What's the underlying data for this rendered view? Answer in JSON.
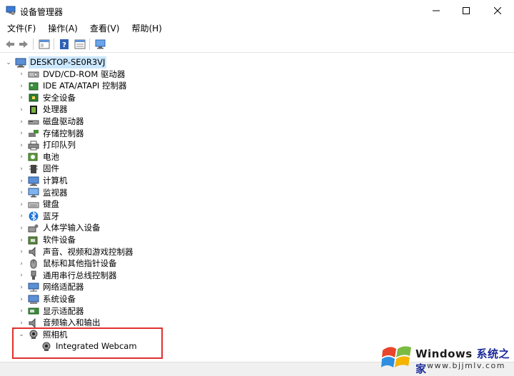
{
  "window": {
    "title": "设备管理器"
  },
  "menubar": {
    "items": [
      "文件(F)",
      "操作(A)",
      "查看(V)",
      "帮助(H)"
    ]
  },
  "tree": {
    "root": "DESKTOP-SE0R3VJ",
    "categories": [
      {
        "label": "DVD/CD-ROM 驱动器",
        "icon": "dvd-drive-icon"
      },
      {
        "label": "IDE ATA/ATAPI 控制器",
        "icon": "ide-controller-icon"
      },
      {
        "label": "安全设备",
        "icon": "security-device-icon"
      },
      {
        "label": "处理器",
        "icon": "processor-icon"
      },
      {
        "label": "磁盘驱动器",
        "icon": "disk-drive-icon"
      },
      {
        "label": "存储控制器",
        "icon": "storage-controller-icon"
      },
      {
        "label": "打印队列",
        "icon": "printer-icon"
      },
      {
        "label": "电池",
        "icon": "battery-icon"
      },
      {
        "label": "固件",
        "icon": "firmware-icon"
      },
      {
        "label": "计算机",
        "icon": "computer-icon"
      },
      {
        "label": "监视器",
        "icon": "monitor-icon"
      },
      {
        "label": "键盘",
        "icon": "keyboard-icon"
      },
      {
        "label": "蓝牙",
        "icon": "bluetooth-icon"
      },
      {
        "label": "人体学输入设备",
        "icon": "hid-icon"
      },
      {
        "label": "软件设备",
        "icon": "software-device-icon"
      },
      {
        "label": "声音、视频和游戏控制器",
        "icon": "sound-icon"
      },
      {
        "label": "鼠标和其他指针设备",
        "icon": "mouse-icon"
      },
      {
        "label": "通用串行总线控制器",
        "icon": "usb-icon"
      },
      {
        "label": "网络适配器",
        "icon": "network-adapter-icon"
      },
      {
        "label": "系统设备",
        "icon": "system-device-icon"
      },
      {
        "label": "显示适配器",
        "icon": "display-adapter-icon"
      },
      {
        "label": "音频输入和输出",
        "icon": "audio-io-icon"
      },
      {
        "label": "照相机",
        "icon": "camera-icon",
        "expanded": true
      }
    ],
    "camera_child": {
      "label": "Integrated Webcam",
      "icon": "webcam-icon"
    }
  },
  "watermark": {
    "brand": "Windows",
    "brand_zh": "系统之家",
    "url": "www.bjjmlv.com"
  },
  "colors": {
    "selection": "#cce8ff",
    "highlight_box": "#e0302e"
  }
}
